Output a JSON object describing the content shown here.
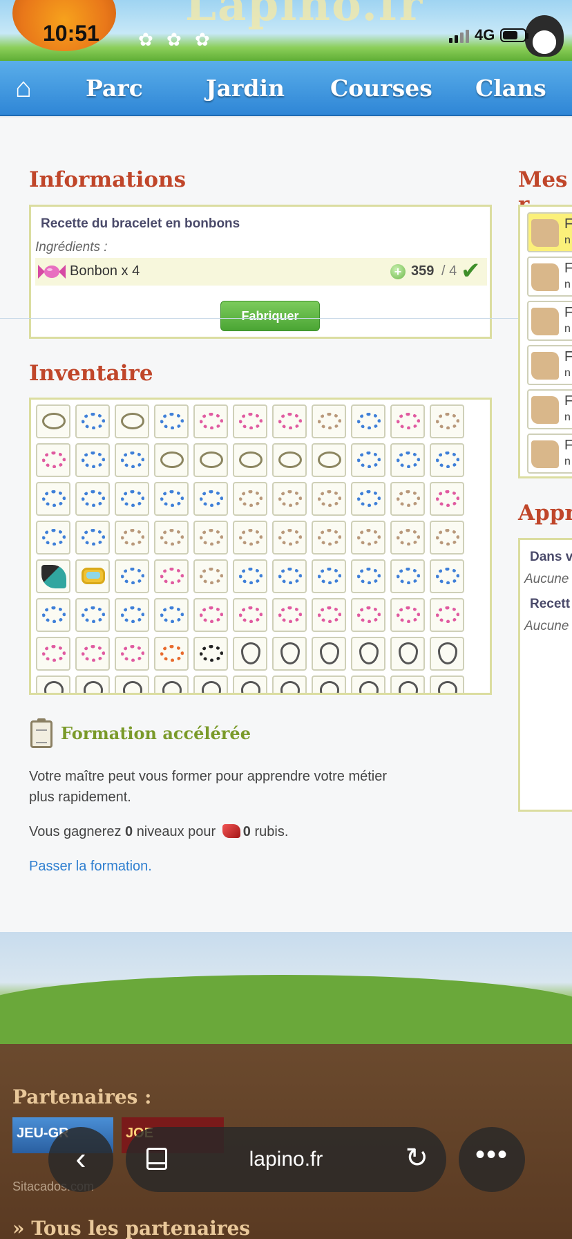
{
  "status_bar": {
    "time": "10:51",
    "network": "4G"
  },
  "nav": {
    "items": [
      "Parc",
      "Jardin",
      "Courses",
      "Clans"
    ]
  },
  "informations": {
    "title": "Informations",
    "recipe_title": "Recette du bracelet en bonbons",
    "ingredients_label": "Ingrédients :",
    "ingredient_name": "Bonbon x 4",
    "have": "359",
    "need": "/ 4",
    "button": "Fabriquer"
  },
  "inventaire": {
    "title": "Inventaire",
    "rows": [
      [
        "rope",
        "blue",
        "rope",
        "blue",
        "pink",
        "pink",
        "pink",
        "beige",
        "blue",
        "pink",
        "beige"
      ],
      [
        "pink",
        "blue",
        "blue",
        "rope",
        "rope",
        "rope",
        "rope",
        "rope",
        "blue",
        "blue",
        "blue"
      ],
      [
        "blue",
        "blue",
        "blue",
        "blue",
        "blue",
        "beige",
        "beige",
        "beige",
        "blue",
        "beige",
        "pink"
      ],
      [
        "blue",
        "blue",
        "beige",
        "beige",
        "beige",
        "beige",
        "beige",
        "beige",
        "beige",
        "beige",
        "beige"
      ],
      [
        "fin",
        "mask",
        "blue",
        "pink",
        "beige",
        "blue",
        "blue",
        "blue",
        "blue",
        "blue",
        "blue"
      ],
      [
        "blue",
        "blue",
        "blue",
        "blue",
        "pink",
        "pink",
        "pink",
        "pink",
        "pink",
        "pink",
        "pink"
      ],
      [
        "pink",
        "pink",
        "pink",
        "rainbow",
        "panda",
        "neck",
        "neck",
        "neck",
        "neck",
        "neck",
        "neck"
      ],
      [
        "neck",
        "neck",
        "neck",
        "neck",
        "neck",
        "neck",
        "neck",
        "neck",
        "neck",
        "neck",
        "neck"
      ]
    ]
  },
  "formation": {
    "title": "Formation accélérée",
    "description": "Votre maître peut vous former pour apprendre votre métier plus rapidement.",
    "gain_prefix": "Vous gagnerez",
    "levels": "0",
    "gain_middle": "niveaux pour",
    "rubies": "0",
    "gain_suffix": "rubis.",
    "skip_link": "Passer la formation."
  },
  "right_column": {
    "mes_title": "Mes r",
    "mes_items": [
      "F",
      "F",
      "F",
      "F",
      "F",
      "F"
    ],
    "mes_sub": "n",
    "appr_title": "Appre",
    "appr_line1": "Dans v",
    "appr_line2": "Aucune",
    "appr_line3": "Recett",
    "appr_line4": "Aucune"
  },
  "footer": {
    "partners_title": "Partenaires :",
    "partner1": "JEU-GR",
    "partner2": "JOE",
    "sitacado": "Sitacados.com",
    "all_partners": "» Tous les partenaires"
  },
  "browser": {
    "url": "lapino.fr"
  }
}
